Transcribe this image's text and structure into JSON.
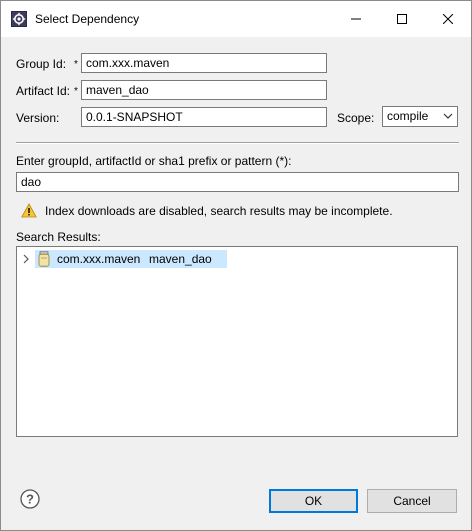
{
  "window": {
    "title": "Select Dependency"
  },
  "form": {
    "group_label": "Group Id:",
    "group_value": "com.xxx.maven",
    "artifact_label": "Artifact Id:",
    "artifact_value": "maven_dao",
    "version_label": "Version:",
    "version_value": "0.0.1-SNAPSHOT",
    "scope_label": "Scope:",
    "scope_value": "compile",
    "required_marker": "*"
  },
  "search": {
    "prompt": "Enter groupId, artifactId or sha1 prefix or pattern (*):",
    "query": "dao",
    "warning": "Index downloads are disabled, search results may be incomplete.",
    "results_label": "Search Results:",
    "results": [
      {
        "group": "com.xxx.maven",
        "artifact": "maven_dao"
      }
    ]
  },
  "buttons": {
    "ok": "OK",
    "cancel": "Cancel"
  },
  "icons": {
    "app": "settings-window-icon",
    "warning": "warning-icon",
    "jar": "jar-icon",
    "help": "help-icon"
  },
  "colors": {
    "selection": "#cce8ff",
    "default_button_border": "#0078d7",
    "warning": "#f5c542"
  }
}
